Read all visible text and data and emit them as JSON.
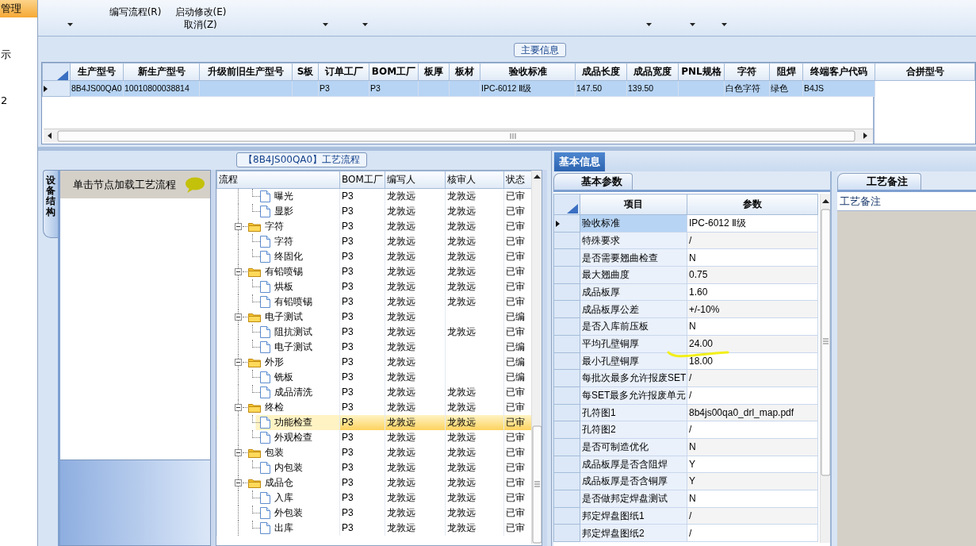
{
  "sidebar": {
    "items": [
      {
        "label": "管理",
        "selected": true
      },
      {
        "label": "示",
        "selected": false
      },
      {
        "label": "2",
        "selected": false
      }
    ]
  },
  "toolbar": {
    "items": [
      {
        "dropdown": true
      },
      {
        "buttons": [
          "编写流程(R)"
        ],
        "dropdown": false
      },
      {
        "buttons": [
          "启动修改(E)",
          "取消(Z)"
        ],
        "dropdown": false
      },
      {
        "dropdown": false
      },
      {
        "dropdown": true
      },
      {
        "dropdown": true
      },
      {
        "dropdown": false
      },
      {
        "dropdown": false
      },
      {
        "dropdown": false
      },
      {
        "dropdown": false
      },
      {
        "dropdown": true
      },
      {
        "dropdown": true
      },
      {
        "dropdown": true
      }
    ]
  },
  "main_info": {
    "title": "主要信息",
    "columns": [
      "生产型号",
      "新生产型号",
      "升级前旧生产型号",
      "S板",
      "订单工厂",
      "BOM工厂",
      "板厚",
      "板材",
      "验收标准",
      "成品长度",
      "成品宽度",
      "PNL规格",
      "字符",
      "阻焊",
      "终端客户代码"
    ],
    "rows": [
      {
        "selected": true,
        "cells": [
          "8B4JS00QA0",
          "10010800038814",
          null,
          null,
          "P3",
          "P3",
          null,
          null,
          "IPC-6012 Ⅱ级",
          "147.50",
          "139.50",
          null,
          "白色字符",
          "绿色",
          "B4JS"
        ]
      }
    ],
    "side_column": "合拼型号"
  },
  "flow": {
    "title": "【8B4JS00QA0】工艺流程",
    "side_tab": "设备结构",
    "hint": "单击节点加载工艺流程",
    "columns": [
      "流程",
      "BOM工厂",
      "编写人",
      "核审人",
      "状态"
    ],
    "continued_children": [
      {
        "label": "曝光",
        "bom": "P3",
        "author": "龙敦远",
        "reviewer": "龙敦远",
        "status": "已审",
        "selected": false
      },
      {
        "label": "显影",
        "bom": "P3",
        "author": "龙敦远",
        "reviewer": "龙敦远",
        "status": "已审",
        "selected": false
      }
    ],
    "nodes": [
      {
        "label": "字符",
        "bom": "P3",
        "author": "龙敦远",
        "reviewer": "龙敦远",
        "status": "已审",
        "selected": false,
        "expanded": true,
        "children": [
          {
            "label": "字符",
            "bom": "P3",
            "author": "龙敦远",
            "reviewer": "龙敦远",
            "status": "已审",
            "selected": false
          },
          {
            "label": "终固化",
            "bom": "P3",
            "author": "龙敦远",
            "reviewer": "龙敦远",
            "status": "已审",
            "selected": false
          }
        ]
      },
      {
        "label": "有铅喷锡",
        "bom": "P3",
        "author": "龙敦远",
        "reviewer": "龙敦远",
        "status": "已审",
        "selected": false,
        "expanded": true,
        "children": [
          {
            "label": "烘板",
            "bom": "P3",
            "author": "龙敦远",
            "reviewer": "龙敦远",
            "status": "已审",
            "selected": false
          },
          {
            "label": "有铅喷锡",
            "bom": "P3",
            "author": "龙敦远",
            "reviewer": "龙敦远",
            "status": "已审",
            "selected": false
          }
        ]
      },
      {
        "label": "电子测试",
        "bom": "P3",
        "author": "龙敦远",
        "status": "已编",
        "selected": false,
        "expanded": true,
        "children": [
          {
            "label": "阻抗测试",
            "bom": "P3",
            "author": "龙敦远",
            "reviewer": "龙敦远",
            "status": "已审",
            "selected": false
          },
          {
            "label": "电子测试",
            "bom": "P3",
            "author": "龙敦远",
            "status": "已编",
            "selected": false
          }
        ]
      },
      {
        "label": "外形",
        "bom": "P3",
        "author": "龙敦远",
        "status": "已编",
        "selected": false,
        "expanded": true,
        "children": [
          {
            "label": "铣板",
            "bom": "P3",
            "author": "龙敦远",
            "status": "已编",
            "selected": false
          },
          {
            "label": "成品清洗",
            "bom": "P3",
            "author": "龙敦远",
            "reviewer": "龙敦远",
            "status": "已审",
            "selected": false
          }
        ]
      },
      {
        "label": "终检",
        "bom": "P3",
        "author": "龙敦远",
        "reviewer": "龙敦远",
        "status": "已审",
        "selected": false,
        "expanded": true,
        "children": [
          {
            "label": "功能检查",
            "bom": "P3",
            "author": "龙敦远",
            "reviewer": "龙敦远",
            "status": "已审",
            "selected": true
          },
          {
            "label": "外观检查",
            "bom": "P3",
            "author": "龙敦远",
            "reviewer": "龙敦远",
            "status": "已审",
            "selected": false
          }
        ]
      },
      {
        "label": "包装",
        "bom": "P3",
        "author": "龙敦远",
        "reviewer": "龙敦远",
        "status": "已审",
        "selected": false,
        "expanded": true,
        "children": [
          {
            "label": "内包装",
            "bom": "P3",
            "author": "龙敦远",
            "reviewer": "龙敦远",
            "status": "已审",
            "selected": false
          }
        ]
      },
      {
        "label": "成品仓",
        "bom": "P3",
        "author": "龙敦远",
        "reviewer": "龙敦远",
        "status": "已审",
        "selected": false,
        "expanded": true,
        "children": [
          {
            "label": "入库",
            "bom": "P3",
            "author": "龙敦远",
            "reviewer": "龙敦远",
            "status": "已审",
            "selected": false
          },
          {
            "label": "外包装",
            "bom": "P3",
            "author": "龙敦远",
            "reviewer": "龙敦远",
            "status": "已审",
            "selected": false
          },
          {
            "label": "出库",
            "bom": "P3",
            "author": "龙敦远",
            "reviewer": "龙敦远",
            "status": "已审",
            "selected": false
          }
        ]
      }
    ]
  },
  "info": {
    "tab": "基本信息",
    "params": {
      "tab": "基本参数",
      "columns": [
        "项目",
        "参数"
      ],
      "rows": [
        {
          "item": "验收标准",
          "value": "IPC-6012 Ⅱ级",
          "selected": true
        },
        {
          "item": "特殊要求",
          "value": "/",
          "selected": false
        },
        {
          "item": "是否需要翘曲检查",
          "value": "N",
          "selected": false
        },
        {
          "item": "最大翘曲度",
          "value": "0.75",
          "selected": false
        },
        {
          "item": "成品板厚",
          "value": "1.60",
          "selected": false
        },
        {
          "item": "成品板厚公差",
          "value": "+/-10%",
          "selected": false
        },
        {
          "item": "是否入库前压板",
          "value": "N",
          "selected": false
        },
        {
          "item": "平均孔壁铜厚",
          "value": "24.00",
          "selected": false
        },
        {
          "item": "最小孔壁铜厚",
          "value": "18.00",
          "selected": false
        },
        {
          "item": "每批次最多允许报废SET",
          "value": "/",
          "selected": false
        },
        {
          "item": "每SET最多允许报废单元",
          "value": "/",
          "selected": false
        },
        {
          "item": "孔符图1",
          "value": "8b4js00qa0_drl_map.pdf",
          "selected": false
        },
        {
          "item": "孔符图2",
          "value": "/",
          "selected": false
        },
        {
          "item": "是否可制造优化",
          "value": "N",
          "selected": false
        },
        {
          "item": "成品板厚是否含阻焊",
          "value": "Y",
          "selected": false
        },
        {
          "item": "成品板厚是否含铜厚",
          "value": "Y",
          "selected": false
        },
        {
          "item": "是否做邦定焊盘测试",
          "value": "N",
          "selected": false
        },
        {
          "item": "邦定焊盘图纸1",
          "value": "/",
          "selected": false
        },
        {
          "item": "邦定焊盘图纸2",
          "value": "/",
          "selected": false
        }
      ]
    },
    "notes": {
      "tab": "工艺备注",
      "label": "工艺备注"
    }
  }
}
